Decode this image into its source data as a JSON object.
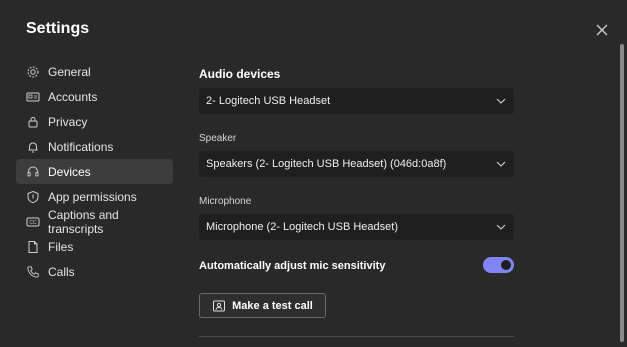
{
  "window": {
    "title": "Settings"
  },
  "nav": {
    "items": [
      {
        "label": "General",
        "icon": "gear-icon"
      },
      {
        "label": "Accounts",
        "icon": "id-card-icon"
      },
      {
        "label": "Privacy",
        "icon": "lock-icon"
      },
      {
        "label": "Notifications",
        "icon": "bell-icon"
      },
      {
        "label": "Devices",
        "icon": "headset-icon",
        "active": true
      },
      {
        "label": "App permissions",
        "icon": "shield-icon"
      },
      {
        "label": "Captions and transcripts",
        "icon": "cc-icon"
      },
      {
        "label": "Files",
        "icon": "file-icon"
      },
      {
        "label": "Calls",
        "icon": "phone-icon"
      }
    ]
  },
  "devices": {
    "section_title": "Audio devices",
    "audio_device_value": "2- Logitech USB Headset",
    "speaker_label": "Speaker",
    "speaker_value": "Speakers (2- Logitech USB Headset) (046d:0a8f)",
    "microphone_label": "Microphone",
    "microphone_value": "Microphone (2- Logitech USB Headset)",
    "auto_adjust_label": "Automatically adjust mic sensitivity",
    "auto_adjust_on": true,
    "test_call_label": "Make a test call"
  },
  "colors": {
    "accent": "#7f85f5",
    "background": "#292929",
    "active_item": "#3d3d3d"
  }
}
